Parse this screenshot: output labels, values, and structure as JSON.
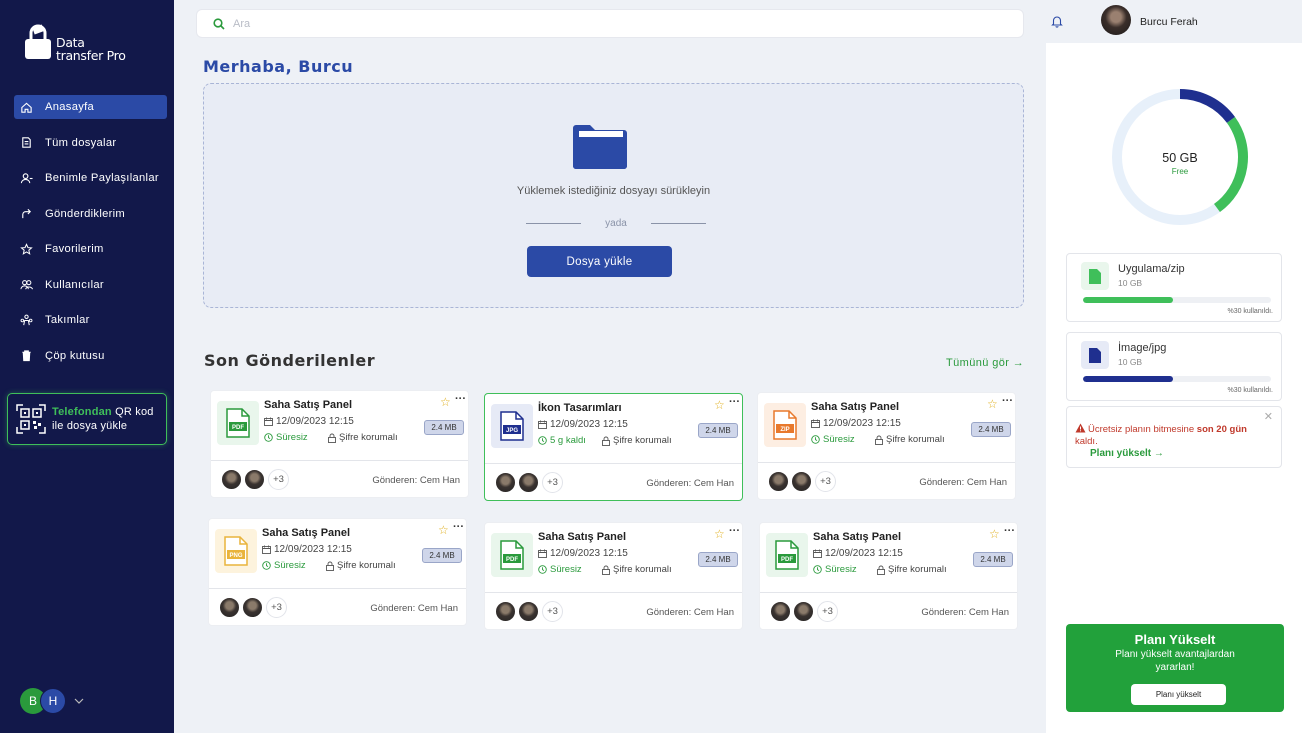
{
  "app": {
    "name_line1": "Data",
    "name_line2": "transfer Pro"
  },
  "sidebar": {
    "items": [
      {
        "label": "Anasayfa",
        "icon": "home-icon"
      },
      {
        "label": "Tüm dosyalar",
        "icon": "file-icon"
      },
      {
        "label": "Benimle Paylaşılanlar",
        "icon": "user-icon"
      },
      {
        "label": "Gönderdiklerim",
        "icon": "share-icon"
      },
      {
        "label": "Favorilerim",
        "icon": "star-icon"
      },
      {
        "label": "Kullanıcılar",
        "icon": "users-icon"
      },
      {
        "label": "Takımlar",
        "icon": "team-icon"
      },
      {
        "label": "Çöp kutusu",
        "icon": "trash-icon"
      }
    ],
    "qr": {
      "highlight": "Telefondan",
      "text1": " QR kod",
      "text2": "ile dosya yükle"
    },
    "avatars": [
      "B",
      "H"
    ]
  },
  "search": {
    "placeholder": "Ara"
  },
  "greeting": "Merhaba, Burcu",
  "upload": {
    "drop_text": "Yüklemek istediğiniz dosyayı sürükleyin",
    "or_text": "yada",
    "button": "Dosya yükle"
  },
  "recent": {
    "title": "Son Gönderilenler",
    "see_all": "Tümünü gör →",
    "cards": [
      {
        "title": "Saha Satış Panel",
        "date": "12/09/2023 12:15",
        "status": "Süresiz",
        "lock": "Şifre korumalı",
        "size": "2.4 MB",
        "more": "+3",
        "sender": "Gönderen: Cem Han",
        "type": "PDF"
      },
      {
        "title": "İkon Tasarımları",
        "date": "12/09/2023 12:15",
        "status": "5 g kaldı",
        "lock": "Şifre korumalı",
        "size": "2.4 MB",
        "more": "+3",
        "sender": "Gönderen: Cem Han",
        "type": "JPG"
      },
      {
        "title": "Saha Satış Panel",
        "date": "12/09/2023 12:15",
        "status": "Süresiz",
        "lock": "Şifre korumalı",
        "size": "2.4 MB",
        "more": "+3",
        "sender": "Gönderen: Cem Han",
        "type": "ZIP"
      },
      {
        "title": "Saha Satış Panel",
        "date": "12/09/2023 12:15",
        "status": "Süresiz",
        "lock": "Şifre korumalı",
        "size": "2.4 MB",
        "more": "+3",
        "sender": "Gönderen: Cem Han",
        "type": "PNG"
      },
      {
        "title": "Saha Satış Panel",
        "date": "12/09/2023 12:15",
        "status": "Süresiz",
        "lock": "Şifre korumalı",
        "size": "2.4 MB",
        "more": "+3",
        "sender": "Gönderen: Cem Han",
        "type": "PDF"
      },
      {
        "title": "Saha Satış Panel",
        "date": "12/09/2023 12:15",
        "status": "Süresiz",
        "lock": "Şifre korumalı",
        "size": "2.4 MB",
        "more": "+3",
        "sender": "Gönderen: Cem Han",
        "type": "PDF"
      }
    ]
  },
  "user": {
    "name": "Burcu Ferah"
  },
  "storage": {
    "free_value": "50 GB",
    "free_label": "Free",
    "segments": {
      "blue_fraction": 0.15,
      "green_fraction": 0.25
    },
    "types": [
      {
        "name": "Uygulama/zip",
        "size": "10 GB",
        "usage": "%30 kullanıldı.",
        "percent": 48,
        "color": "#3fbf5a"
      },
      {
        "name": "İmage/jpg",
        "size": "10 GB",
        "usage": "%30 kullanıldı.",
        "percent": 48,
        "color": "#1f2f8f"
      }
    ]
  },
  "warning": {
    "prefix": "Ücretsiz planın bitmesine ",
    "days": "son 20 gün",
    "suffix": "kaldı.",
    "link": "Planı yükselt →"
  },
  "upgrade": {
    "title": "Planı Yükselt",
    "subtitle": "Planı yükselt avantajlardan yararlan!",
    "button": "Planı yükselt"
  },
  "colors": {
    "sidebar": "#12184a",
    "accent": "#2b4aa6",
    "green": "#2a9a3c"
  }
}
